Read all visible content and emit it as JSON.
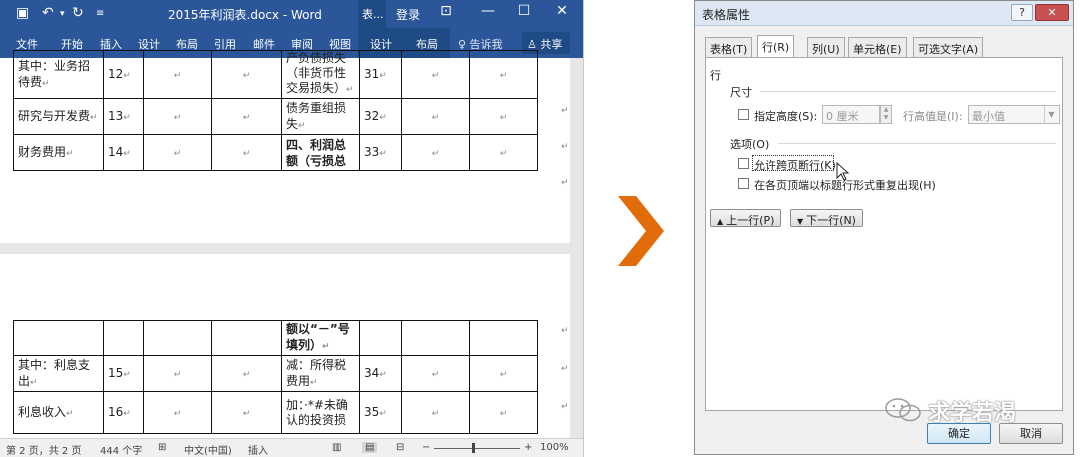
{
  "word": {
    "title": "2015年利润表.docx - Word",
    "context_tab": "表...",
    "login": "登录",
    "ribbon_tabs": [
      "文件",
      "开始",
      "插入",
      "设计",
      "布局",
      "引用",
      "邮件",
      "审阅",
      "视图"
    ],
    "context_tabs": [
      "设计",
      "布局"
    ],
    "tell_me": "♀ 告诉我",
    "share": "♙ 共享",
    "page1_rows": [
      {
        "name": "其中：业务招待费",
        "num": "12",
        "item": "产负债损失（非货币性交易损失）",
        "line": "31",
        "bold": false
      },
      {
        "name": "研究与开发费",
        "num": "13",
        "item": "债务重组损失",
        "line": "32",
        "bold": false
      },
      {
        "name": "财务费用",
        "num": "14",
        "item": "四、利润总额（亏损总",
        "line": "33",
        "bold": true
      }
    ],
    "page2_rows": [
      {
        "name": "",
        "num": "",
        "item": "额以“－”号填列）",
        "line": "",
        "bold": true
      },
      {
        "name": "其中：利息支出",
        "num": "15",
        "item": "减：所得税费用",
        "line": "34",
        "bold": false
      },
      {
        "name": "利息收入",
        "num": "16",
        "item": "加：·*#未确认的投资损",
        "line": "35",
        "bold": false
      }
    ],
    "status": {
      "page": "第 2 页，共 2 页",
      "words": "444 个字",
      "language": "中文(中国)",
      "mode": "插入",
      "zoom": "100%"
    }
  },
  "dialog": {
    "title": "表格属性",
    "help": "?",
    "close": "✕",
    "tabs": [
      "表格(T)",
      "行(R)",
      "列(U)",
      "单元格(E)",
      "可选文字(A)"
    ],
    "active_tab": "行(R)",
    "section_row": "行",
    "size_label": "尺寸",
    "specify_height": "指定高度(S):",
    "height_value": "0 厘米",
    "row_height_is": "行高值是(I):",
    "row_height_mode": "最小值",
    "options_label": "选项(O)",
    "allow_break": "允许跨页断行(K)",
    "repeat_header": "在各页顶端以标题行形式重复出现(H)",
    "prev_row": "上一行(P)",
    "next_row": "下一行(N)",
    "ok": "确定",
    "cancel": "取消"
  },
  "watermark": "求学若渴",
  "colors": {
    "word_blue": "#2b579a",
    "arrow_orange": "#e36c0a"
  }
}
